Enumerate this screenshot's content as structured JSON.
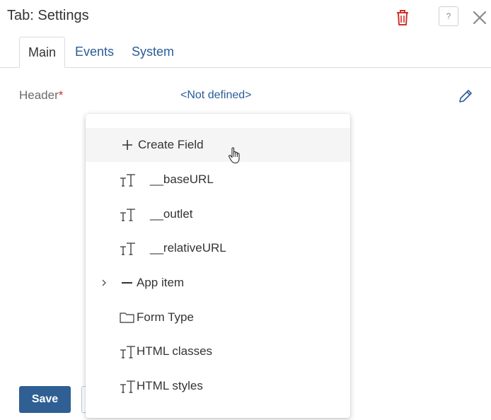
{
  "header": {
    "title": "Tab: Settings",
    "help_label": "?"
  },
  "tabs": [
    {
      "label": "Main",
      "active": true
    },
    {
      "label": "Events",
      "active": false
    },
    {
      "label": "System",
      "active": false
    }
  ],
  "form": {
    "header_label": "Header",
    "required_mark": "*",
    "header_value": "<Not defined>"
  },
  "dropdown": {
    "items": [
      {
        "label": "Create Field",
        "icon": "plus-icon"
      },
      {
        "label": "__baseURL",
        "icon": "text-type-icon"
      },
      {
        "label": "__outlet",
        "icon": "text-type-icon"
      },
      {
        "label": "__relativeURL",
        "icon": "text-type-icon"
      },
      {
        "label": "App item",
        "icon": "dash-icon",
        "expandable": true
      },
      {
        "label": "Form Type",
        "icon": "folder-icon"
      },
      {
        "label": "HTML classes",
        "icon": "text-type-icon"
      },
      {
        "label": "HTML styles",
        "icon": "text-type-icon"
      }
    ]
  },
  "footer": {
    "save_label": "Save"
  },
  "colors": {
    "link": "#2a5d97",
    "danger": "#d0312d",
    "primary_button": "#2f5f93"
  }
}
